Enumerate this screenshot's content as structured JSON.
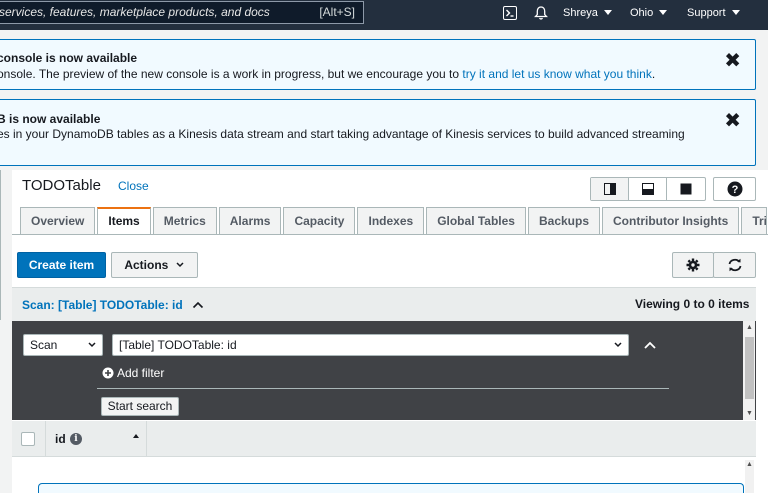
{
  "topbar": {
    "search_placeholder": "services, features, marketplace products, and docs",
    "search_shortcut": "[Alt+S]",
    "user": "Shreya",
    "region": "Ohio",
    "support": "Support"
  },
  "flash1": {
    "title": "console is now available",
    "body_prefix": "onsole. The preview of the new console is a work in progress, but we encourage you to",
    "link": "try it and let us know what you think",
    "body_suffix": "."
  },
  "flash2": {
    "title": "B is now available",
    "body": "es in your DynamoDB tables as a Kinesis data stream and start taking advantage of Kinesis services to build advanced streaming"
  },
  "table": {
    "name": "TODOTable",
    "close": "Close"
  },
  "tabs": [
    "Overview",
    "Items",
    "Metrics",
    "Alarms",
    "Capacity",
    "Indexes",
    "Global Tables",
    "Backups",
    "Contributor Insights",
    "Tri"
  ],
  "actions": {
    "create_item": "Create item",
    "actions": "Actions"
  },
  "scan": {
    "label": "Scan: [Table] TODOTable: id",
    "viewing": "Viewing 0 to 0 items",
    "mode": "Scan",
    "target": "[Table] TODOTable: id",
    "add_filter": "Add filter",
    "start_search": "Start search"
  },
  "columns": {
    "id": "id"
  },
  "colors": {
    "header_bg": "#232f3e",
    "primary": "#0073bb",
    "tab_accent": "#ec7211"
  }
}
